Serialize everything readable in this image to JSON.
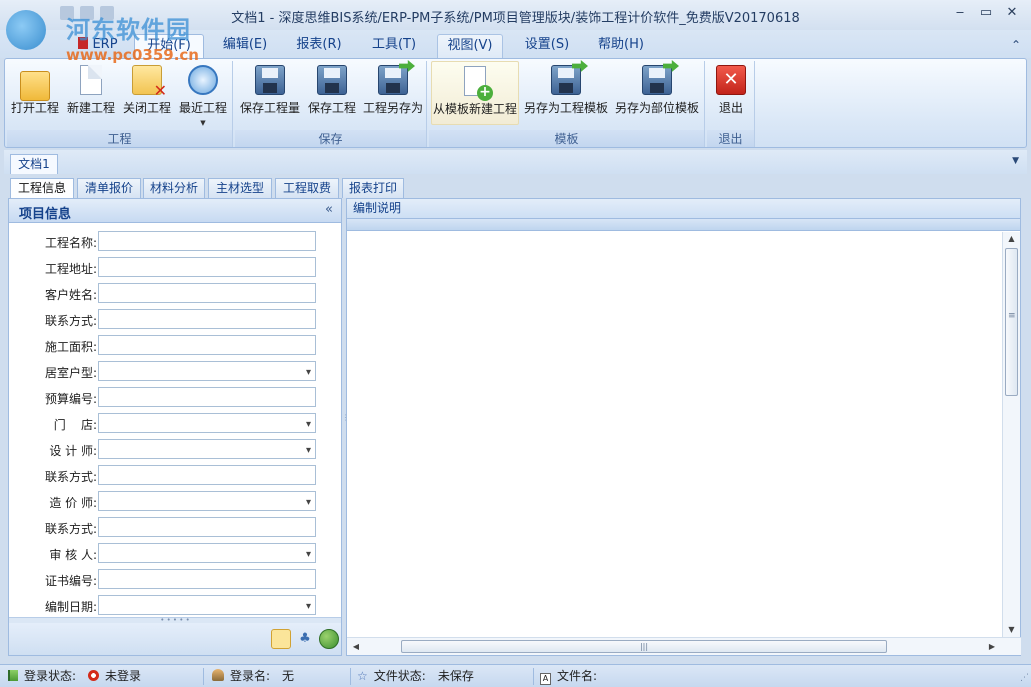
{
  "watermark": {
    "title": "河东软件园",
    "url": "www.pc0359.cn"
  },
  "window": {
    "title": "文档1 - 深度思维BIS系统/ERP-PM子系统/PM项目管理版块/装饰工程计价软件_免费版V20170618",
    "minimize": "‒",
    "maximize": "▭",
    "close": "✕"
  },
  "ribbon_tabs": [
    "ERP",
    "开始(F)",
    "编辑(E)",
    "报表(R)",
    "工具(T)",
    "视图(V)",
    "设置(S)",
    "帮助(H)"
  ],
  "ribbon_collapse": "⌃",
  "ribbon_groups": [
    {
      "label": "工程",
      "buttons": [
        "打开工程",
        "新建工程",
        "关闭工程",
        "最近工程"
      ]
    },
    {
      "label": "保存",
      "buttons": [
        "保存工程量",
        "保存工程",
        "工程另存为"
      ]
    },
    {
      "label": "模板",
      "buttons": [
        "从模板新建工程",
        "另存为工程模板",
        "另存为部位模板"
      ]
    },
    {
      "label": "退出",
      "buttons": [
        "退出"
      ]
    }
  ],
  "doc_tab": "文档1",
  "inner_tabs": [
    "工程信息",
    "清单报价",
    "材料分析",
    "主材选型",
    "工程取费",
    "报表打印"
  ],
  "left_panel": {
    "title": "项目信息",
    "collapse": "«",
    "fields": [
      {
        "label": "工程名称:",
        "type": "text",
        "value": ""
      },
      {
        "label": "工程地址:",
        "type": "text",
        "value": ""
      },
      {
        "label": "客户姓名:",
        "type": "text",
        "value": ""
      },
      {
        "label": "联系方式:",
        "type": "text",
        "value": ""
      },
      {
        "label": "施工面积:",
        "type": "text",
        "value": ""
      },
      {
        "label": "居室户型:",
        "type": "select",
        "value": ""
      },
      {
        "label": "预算编号:",
        "type": "text",
        "value": ""
      },
      {
        "label": "门    店:",
        "type": "select",
        "value": ""
      },
      {
        "label": "设 计 师:",
        "type": "select",
        "value": ""
      },
      {
        "label": "联系方式:",
        "type": "text",
        "value": ""
      },
      {
        "label": "造 价 师:",
        "type": "select",
        "value": ""
      },
      {
        "label": "联系方式:",
        "type": "text",
        "value": ""
      },
      {
        "label": "审 核 人:",
        "type": "select",
        "value": ""
      },
      {
        "label": "证书编号:",
        "type": "text",
        "value": ""
      },
      {
        "label": "编制日期:",
        "type": "select",
        "value": ""
      }
    ]
  },
  "right_panel": {
    "title": "编制说明"
  },
  "statusbar": {
    "login_status_label": "登录状态:",
    "login_status_value": "未登录",
    "login_name_label": "登录名:",
    "login_name_value": "无",
    "file_status_label": "文件状态:",
    "file_status_value": "未保存",
    "file_name_label": "文件名:",
    "file_name_value": ""
  },
  "colors": {
    "accent": "#15428b",
    "ribbon_border": "#9fbbe0",
    "background": "#cfddee"
  }
}
